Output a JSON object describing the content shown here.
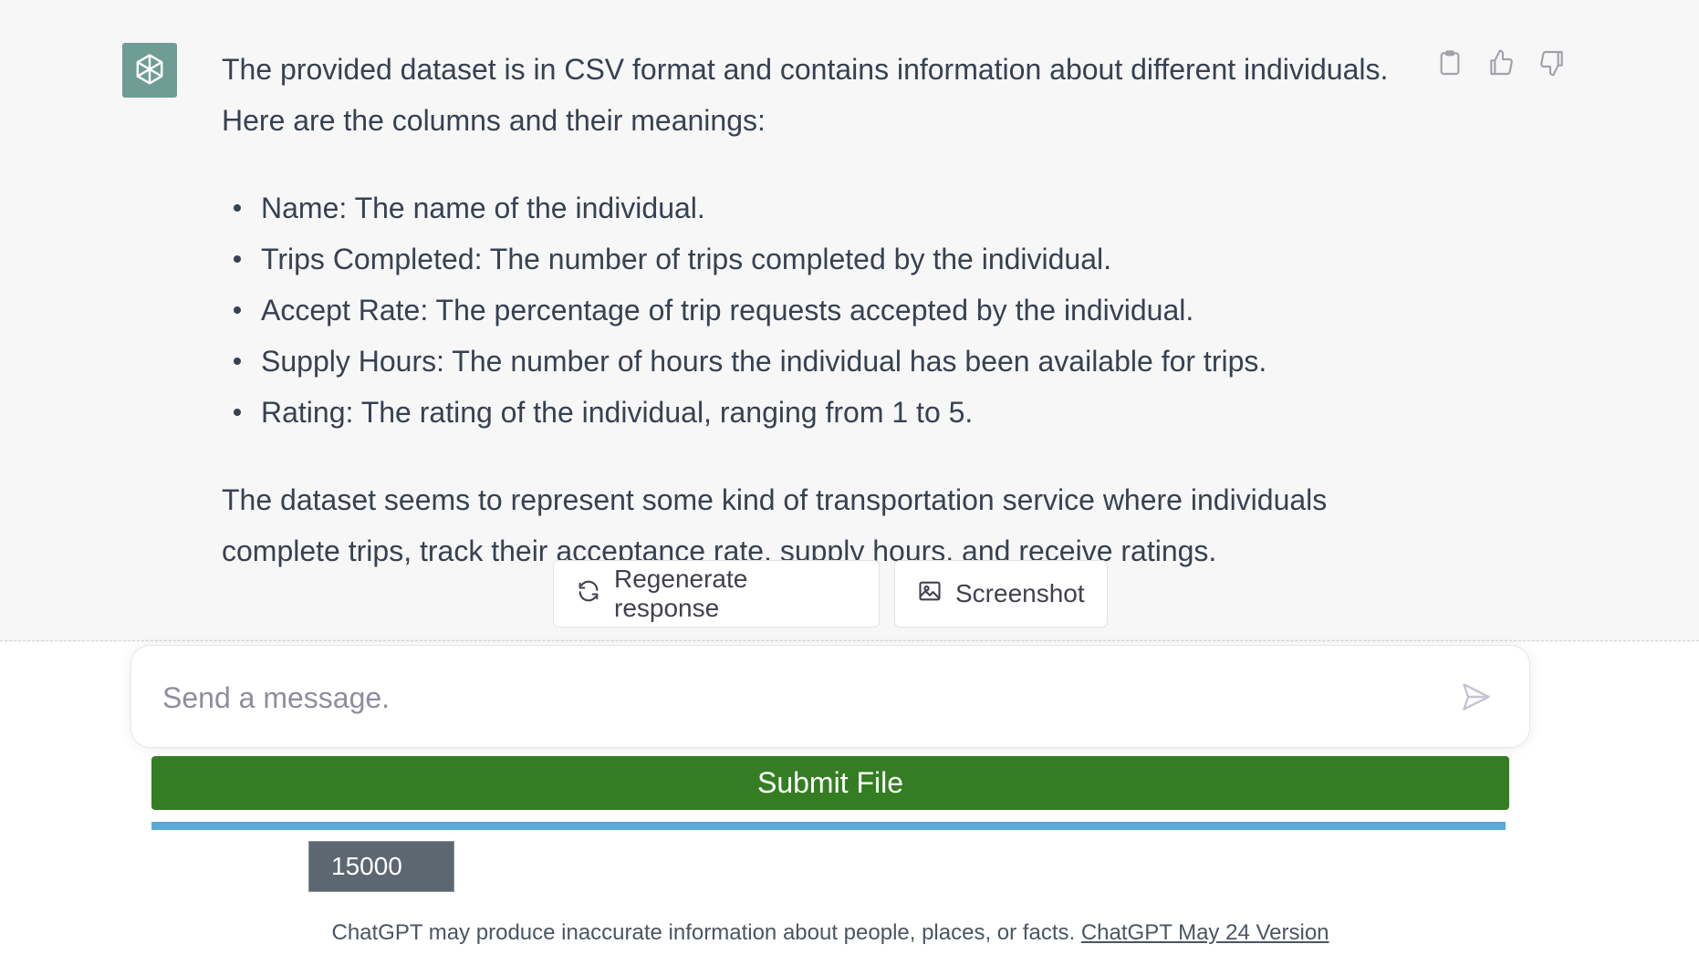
{
  "message": {
    "intro": "The provided dataset is in CSV format and contains information about different individuals. Here are the columns and their meanings:",
    "columns": [
      "Name: The name of the individual.",
      "Trips Completed: The number of trips completed by the individual.",
      "Accept Rate: The percentage of trip requests accepted by the individual.",
      "Supply Hours: The number of hours the individual has been available for trips.",
      "Rating: The rating of the individual, ranging from 1 to 5."
    ],
    "summary": "The dataset seems to represent some kind of transportation service where individuals complete trips, track their acceptance rate, supply hours, and receive ratings.",
    "avatar_icon": "openai-logo-icon",
    "action_icons": [
      "clipboard-icon",
      "thumbs-up-icon",
      "thumbs-down-icon"
    ]
  },
  "buttons": {
    "regenerate": "Regenerate response",
    "screenshot": "Screenshot",
    "submit": "Submit File"
  },
  "input": {
    "placeholder": "Send a message.",
    "value": ""
  },
  "progress": {
    "fraction": 1.0
  },
  "count_badge": "15000",
  "footer": {
    "text": "ChatGPT may produce inaccurate information about people, places, or facts.",
    "link": "ChatGPT May 24 Version"
  },
  "colors": {
    "avatar": "#6f9c94",
    "submit": "#357d23",
    "progress": "#5ba9d6",
    "badge": "#5c6772",
    "message_bg": "#f7f7f8"
  }
}
